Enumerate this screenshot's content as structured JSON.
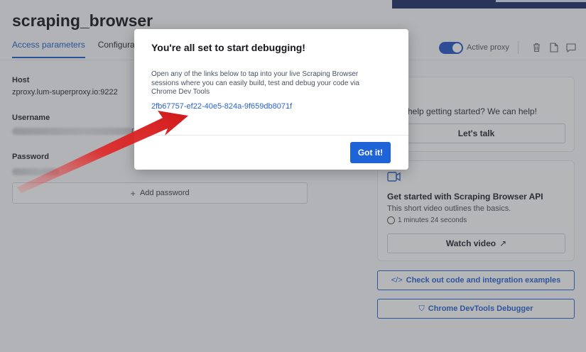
{
  "page": {
    "title": "scraping_browser",
    "tabs": [
      {
        "label": "Access parameters",
        "active": true
      },
      {
        "label": "Configura"
      }
    ]
  },
  "toolbar": {
    "active_proxy_label": "Active proxy",
    "toggle_on": true,
    "icons": [
      "trash-icon",
      "document-icon",
      "comment-icon"
    ]
  },
  "credentials": {
    "host_label": "Host",
    "host_value": "zproxy.lum-superproxy.io:9222",
    "username_label": "Username",
    "password_label": "Password",
    "add_password_label": "Add password",
    "username_partial_char": "r"
  },
  "help_card": {
    "text": "help getting started? We can help!",
    "button_label": "Let's talk"
  },
  "video_card": {
    "icon": "video-camera-icon",
    "title": "Get started with Scraping Browser API",
    "subtitle": "This short video outlines the basics.",
    "duration": "1 minutes 24 seconds",
    "button_label": "Watch video",
    "button_icon": "↗"
  },
  "actions": {
    "code_examples_label": "Check out code and integration examples",
    "code_examples_icon": "</>",
    "devtools_label": "Chrome DevTools Debugger",
    "devtools_icon": "⛉"
  },
  "modal": {
    "title": "You're all set to start debugging!",
    "body": "Open any of the links below to tap into your live Scraping Browser sessions where you can easily build, test and debug your code via Chrome Dev Tools",
    "link": "2fb67757-ef22-40e5-824a-9f659db8071f",
    "confirm_label": "Got it!"
  },
  "colors": {
    "accent": "#1f63d9",
    "link": "#2a62d0",
    "annotation_arrow": "#e02020",
    "topbar": "#1c2f66"
  }
}
